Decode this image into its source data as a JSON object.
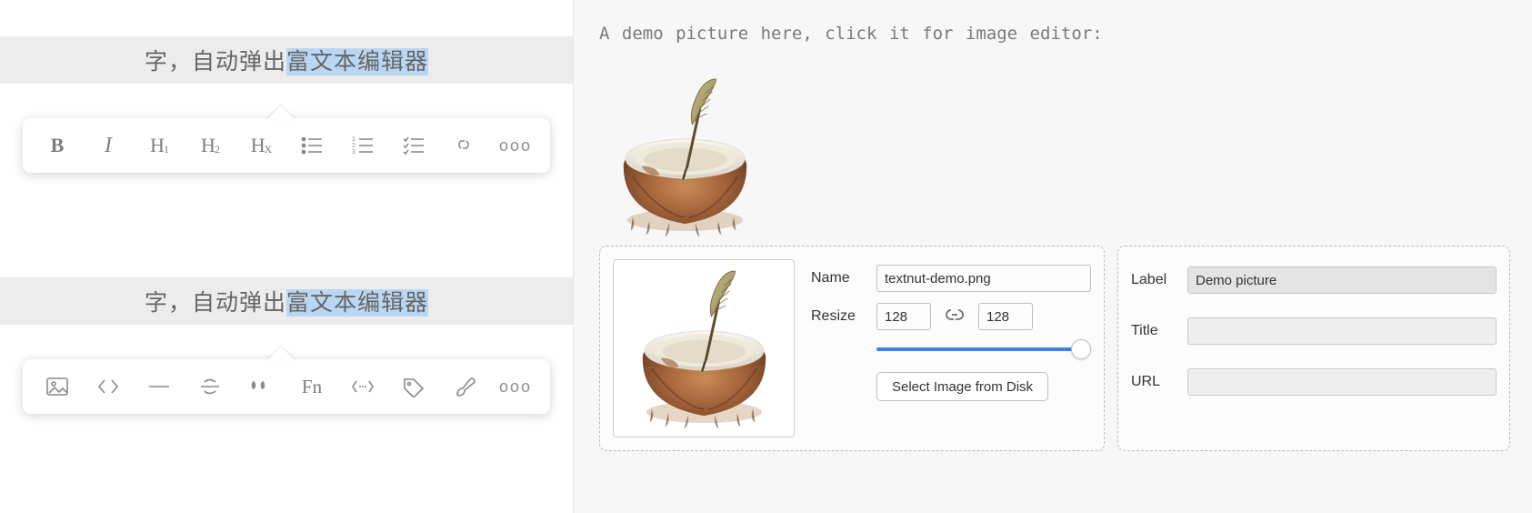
{
  "left": {
    "sample_text_prefix": "字，自动弹出",
    "sample_text_highlight": "富文本编辑器",
    "toolbar1": {
      "bold": "B",
      "italic": "I",
      "h1": "H1",
      "h2": "H2",
      "hx": "HX",
      "more": "ooo"
    },
    "toolbar2": {
      "fn": "Fn",
      "more": "ooo"
    }
  },
  "right": {
    "caption": "A demo picture here, click it for image editor:",
    "editor": {
      "name_label": "Name",
      "name_value": "textnut-demo.png",
      "resize_label": "Resize",
      "resize_w": "128",
      "resize_h": "128",
      "select_btn": "Select Image from Disk",
      "label_label": "Label",
      "label_value": "Demo picture",
      "title_label": "Title",
      "title_value": "",
      "url_label": "URL",
      "url_value": ""
    }
  }
}
